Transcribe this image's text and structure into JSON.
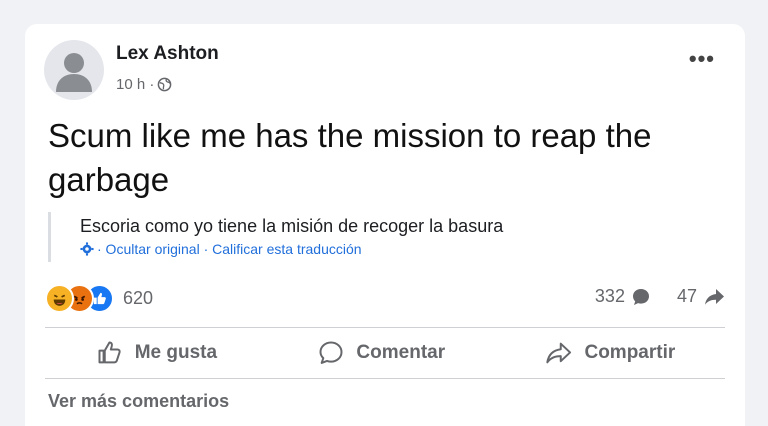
{
  "post": {
    "author": "Lex Ashton",
    "time": "10 h ·",
    "privacy_icon": "globe-icon",
    "more_icon": "more-options-icon",
    "text": "Scum like me has the mission to reap the garbage",
    "translation": {
      "text": "Escoria como yo tiene la misión de recoger la basura",
      "links": "· Ocultar original · Calificar esta traducción",
      "settings_icon": "gear-icon"
    },
    "reactions": {
      "icons": [
        "haha-reaction-icon",
        "angry-reaction-icon",
        "like-reaction-icon"
      ],
      "count": "620"
    },
    "stats": {
      "comments": "332",
      "comments_icon": "comment-bubble-icon",
      "shares": "47",
      "shares_icon": "share-arrow-icon"
    },
    "actions": {
      "like": "Me gusta",
      "comment": "Comentar",
      "share": "Compartir"
    },
    "see_more_comments": "Ver más comentarios"
  },
  "colors": {
    "link": "#216fdb",
    "muted": "#65676b",
    "like_blue": "#1877f2",
    "haha_yellow": "#f7b125",
    "angry_orange": "#e9710f"
  }
}
